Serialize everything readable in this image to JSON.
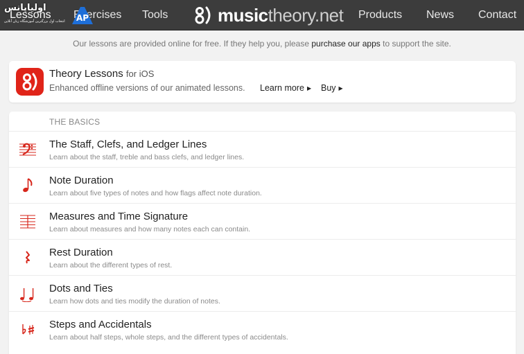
{
  "nav": {
    "items": [
      {
        "label": "Lessons",
        "active": true
      },
      {
        "label": "Exercises",
        "active": false
      },
      {
        "label": "Tools",
        "active": false
      },
      {
        "label": "Products",
        "active": false
      },
      {
        "label": "News",
        "active": false
      },
      {
        "label": "Contact",
        "active": false
      }
    ],
    "logo_bold": "music",
    "logo_light": "theory.net"
  },
  "watermark": {
    "text": "اولیاپانس",
    "subtext": "انتخاب اول بزرگترین آموزشگاه زبان آنلاین",
    "badge": "AP"
  },
  "notice": {
    "before": "Our lessons are provided online for free. If they help you, please",
    "link": "purchase our apps",
    "after": "to support the site."
  },
  "promo": {
    "title": "Theory Lessons",
    "title_suffix": "for iOS",
    "description": "Enhanced offline versions of our animated lessons.",
    "learn_more": "Learn more",
    "buy": "Buy"
  },
  "section": {
    "heading": "THE BASICS",
    "lessons": [
      {
        "title": "The Staff, Clefs, and Ledger Lines",
        "description": "Learn about the staff, treble and bass clefs, and ledger lines.",
        "icon": "bass-clef-icon"
      },
      {
        "title": "Note Duration",
        "description": "Learn about five types of notes and how flags affect note duration.",
        "icon": "eighth-note-icon"
      },
      {
        "title": "Measures and Time Signature",
        "description": "Learn about measures and how many notes each can contain.",
        "icon": "staff-lines-icon"
      },
      {
        "title": "Rest Duration",
        "description": "Learn about the different types of rest.",
        "icon": "quarter-rest-icon"
      },
      {
        "title": "Dots and Ties",
        "description": "Learn how dots and ties modify the duration of notes.",
        "icon": "tied-notes-icon"
      },
      {
        "title": "Steps and Accidentals",
        "description": "Learn about half steps, whole steps, and the different types of accidentals.",
        "icon": "flat-sharp-icon"
      }
    ]
  },
  "colors": {
    "nav_bg": "#3c3c3c",
    "accent_red": "#d7261b",
    "page_bg": "#f2f2f2"
  }
}
